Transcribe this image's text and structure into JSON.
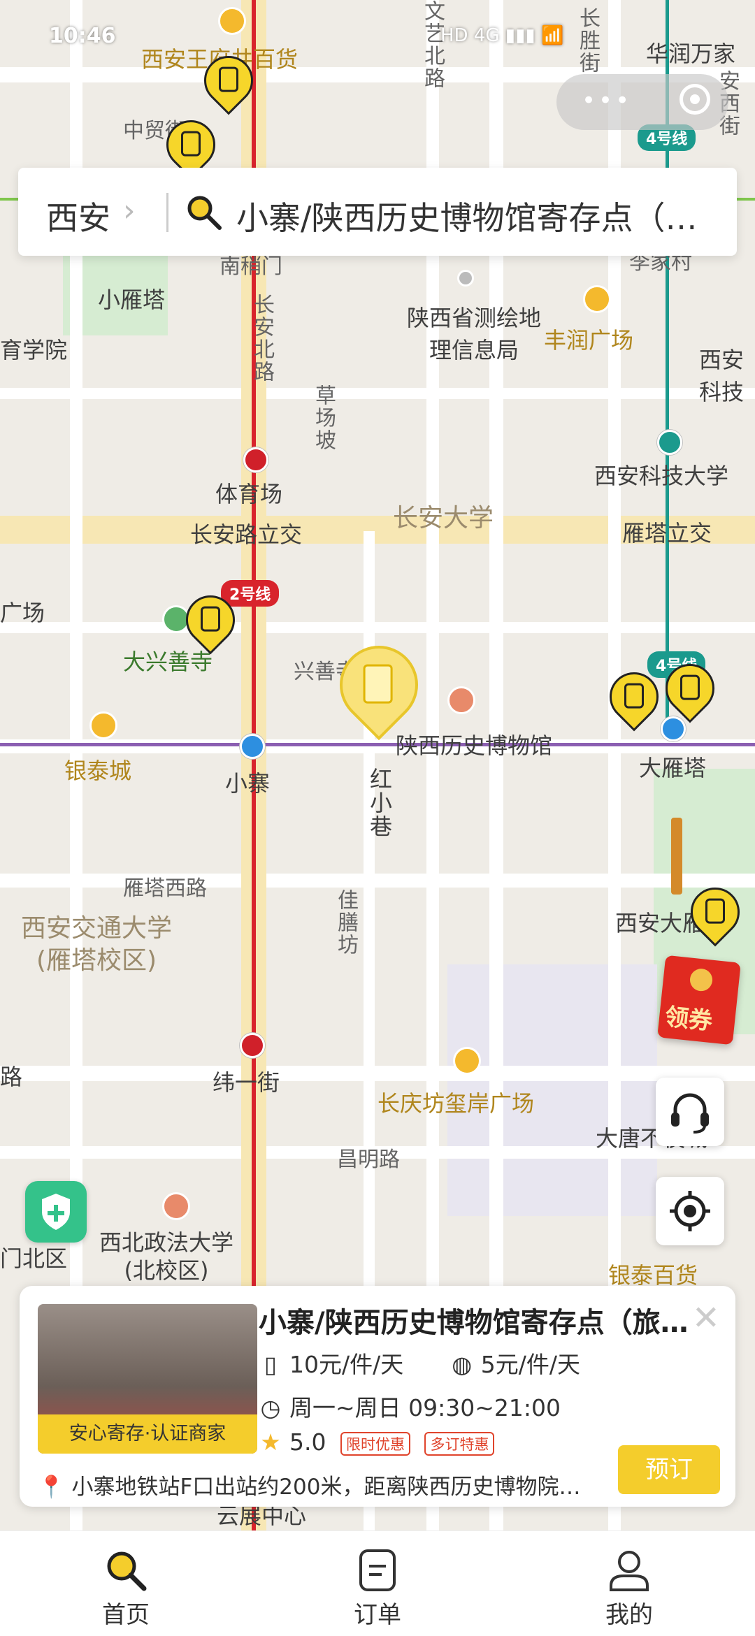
{
  "status_bar": {
    "time": "10:46",
    "signals": "HD 4G ▮▮▮ 📶"
  },
  "capsule": {
    "more": "•••"
  },
  "search": {
    "city": "西安",
    "query": "小寨/陕西历史博物馆寄存点（…"
  },
  "map": {
    "labels": {
      "wangfujing": "西安王府井百货",
      "zhongmao": "中贸街",
      "wenyi": "文艺北路",
      "changsheng": "长胜街",
      "huarun": "华润万家",
      "anxi": "安西街",
      "nanshaomen": "南稍门",
      "lijiacun": "李家村",
      "xiaoyanta": "小雁塔",
      "xueyuan": "育学院",
      "changanbei": "长安北路",
      "cehui": "陕西省测绘地理信息局",
      "fengrun": "丰润广场",
      "keji_right": "西安科技",
      "caochang": "草场坡",
      "tiyuchang": "体育场",
      "xa_keji_uni": "西安科技大学",
      "changan_uni": "长安大学",
      "changanlu_lijiao": "长安路立交",
      "yanta_lijiao": "雁塔立交",
      "guangchang": "广场",
      "daxing": "大兴善寺",
      "xingshan": "兴善寺东街",
      "yintai": "银泰城",
      "museum": "陕西历史博物馆",
      "dayanta": "大雁塔",
      "xiaozhai": "小寨",
      "hongxiaoxiang": "红小巷",
      "yanta_west": "雁塔西路",
      "jiaoda": "西安交通大学\n(雁塔校区)",
      "zhushan": "佳膳坊",
      "xa_da": "西安大雁塔",
      "weiyi": "纬一街",
      "changqing": "长庆坊玺岸广场",
      "datang": "大唐不夜城",
      "changming": "昌明路",
      "menbei": "门北区",
      "zhengfa": "西北政法大学\n(北校区)",
      "yintai_bh": "银泰百货",
      "lu": "路",
      "yunzhan": "云展中心"
    },
    "lines": {
      "line2": "2号线",
      "line4": "4号线",
      "line4b": "4号线"
    },
    "colors": {
      "line2": "#d8242c",
      "line4": "#1b9a8d",
      "line3": "#8b5fb2",
      "brand": "#f4cd2c"
    }
  },
  "coupon": {
    "label": "领券"
  },
  "card": {
    "title": "小寨/陕西历史博物馆寄存点（旅…",
    "badge": "安心寄存·认证商家",
    "price_large": "10元/件/天",
    "price_small": "5元/件/天",
    "hours": "周一~周日 09:30~21:00",
    "rating": "5.0",
    "tag1": "限时优惠",
    "tag2": "多订特惠",
    "address": "小寨地铁站F口出站约200米，距离陕西历史博物院…",
    "book": "预订",
    "close": "✕"
  },
  "tabs": [
    {
      "label": "首页",
      "icon": "search-icon"
    },
    {
      "label": "订单",
      "icon": "order-icon"
    },
    {
      "label": "我的",
      "icon": "profile-icon"
    }
  ]
}
